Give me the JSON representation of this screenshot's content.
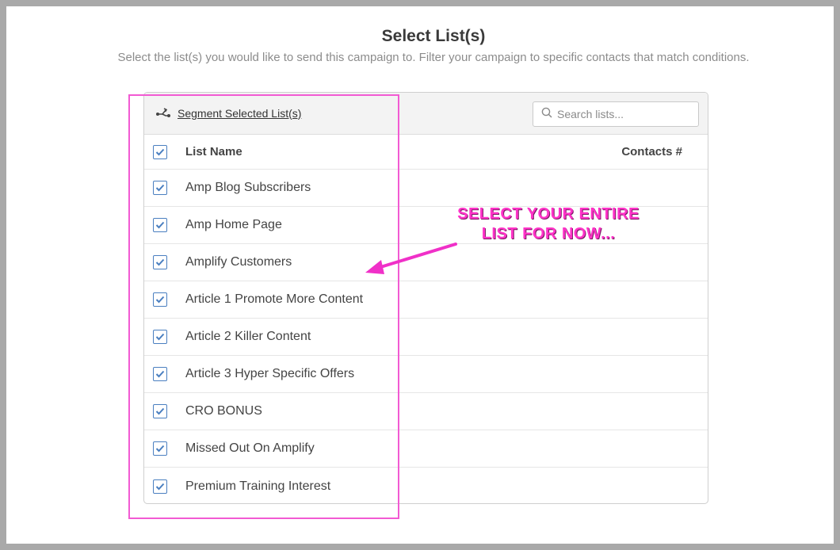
{
  "page": {
    "title": "Select List(s)",
    "subtitle": "Select the list(s) you would like to send this campaign to. Filter your campaign to specific contacts that match conditions."
  },
  "toolbar": {
    "segment_label": "Segment Selected List(s)",
    "search_placeholder": "Search lists..."
  },
  "table": {
    "columns": {
      "name": "List Name",
      "contacts": "Contacts #"
    },
    "select_all_checked": true,
    "rows": [
      {
        "name": "Amp Blog Subscribers",
        "checked": true
      },
      {
        "name": "Amp Home Page",
        "checked": true
      },
      {
        "name": "Amplify Customers",
        "checked": true
      },
      {
        "name": "Article 1 Promote More Content",
        "checked": true
      },
      {
        "name": "Article 2 Killer Content",
        "checked": true
      },
      {
        "name": "Article 3 Hyper Specific Offers",
        "checked": true
      },
      {
        "name": "CRO BONUS",
        "checked": true
      },
      {
        "name": "Missed Out On Amplify",
        "checked": true
      },
      {
        "name": "Premium Training Interest",
        "checked": true
      }
    ]
  },
  "annotation": {
    "line1": "SELECT YOUR ENTIRE",
    "line2": "LIST FOR NOW...",
    "color": "#ff33c8"
  },
  "colors": {
    "checkbox": "#4a7fc0",
    "highlight": "#f25ad3"
  }
}
